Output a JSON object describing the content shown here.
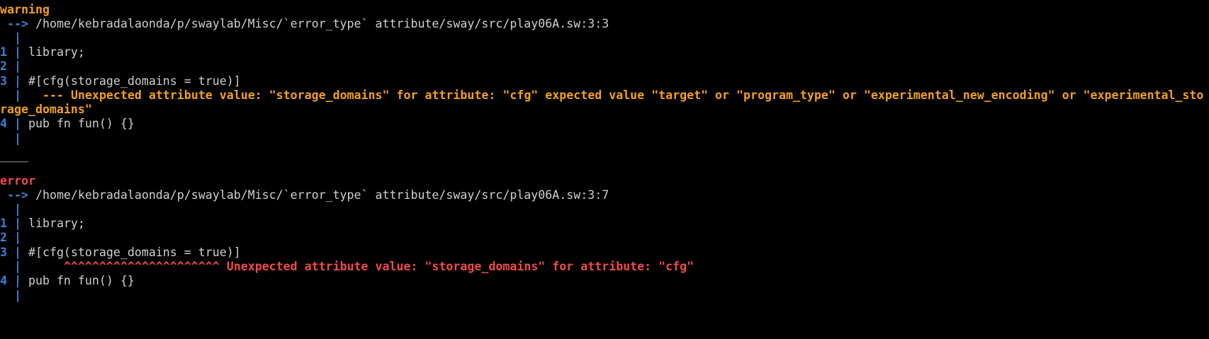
{
  "warning_block": {
    "label": "warning",
    "arrow": " -->",
    "path": "/home/kebradalaonda/p/swaylab/Misc/`error_type` attribute/sway/src/play06A.sw:3:3",
    "lines": [
      {
        "num": "1",
        "code": "library;"
      },
      {
        "num": "2",
        "code": ""
      },
      {
        "num": "3",
        "code": "#[cfg(storage_domains = true)]"
      }
    ],
    "annotation_marker": "---",
    "annotation_text": "Unexpected attribute value: \"storage_domains\" for attribute: \"cfg\" expected value \"target\" or \"program_type\" or \"experimental_new_encoding\" or \"experimental_sto",
    "annotation_wrap": "rage_domains\"",
    "line4": {
      "num": "4",
      "code": "pub fn fun() {}"
    }
  },
  "separator": "____",
  "error_block": {
    "label": "error",
    "arrow": " -->",
    "path": "/home/kebradalaonda/p/swaylab/Misc/`error_type` attribute/sway/src/play06A.sw:3:7",
    "lines": [
      {
        "num": "1",
        "code": "library;"
      },
      {
        "num": "2",
        "code": ""
      },
      {
        "num": "3",
        "code": "#[cfg(storage_domains = true)]"
      }
    ],
    "annotation_marker": "^^^^^^^^^^^^^^^^^^^^^^",
    "annotation_text": "Unexpected attribute value: \"storage_domains\" for attribute: \"cfg\"",
    "line4": {
      "num": "4",
      "code": "pub fn fun() {}"
    }
  },
  "colors": {
    "background": "#000000",
    "gutter": "#3b82d6",
    "warning": "#f0a020",
    "error": "#ef4b48",
    "text": "#d0d0d0"
  }
}
